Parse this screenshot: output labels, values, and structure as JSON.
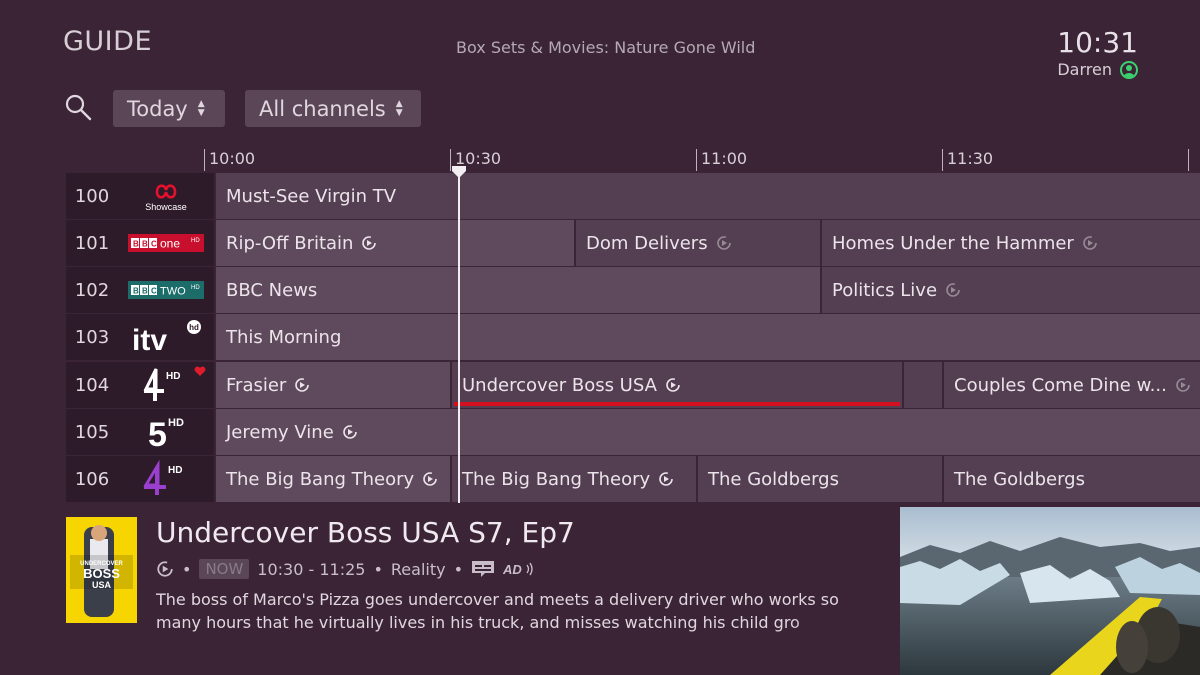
{
  "header": {
    "title": "GUIDE",
    "subtitle": "Box Sets & Movies: Nature Gone Wild",
    "time": "10:31",
    "user": "Darren"
  },
  "filters": {
    "day": "Today",
    "channels": "All channels"
  },
  "timeline": [
    "10:00",
    "10:30",
    "11:00",
    "11:30"
  ],
  "channels": [
    {
      "number": "100",
      "logo": "Showcase",
      "programmes": [
        "Must-See Virgin TV"
      ]
    },
    {
      "number": "101",
      "logo": "BBC one HD",
      "programmes": [
        "Rip-Off Britain",
        "Dom Delivers",
        "Homes Under the Hammer"
      ]
    },
    {
      "number": "102",
      "logo": "BBC TWO HD",
      "programmes": [
        "BBC News",
        "Politics Live"
      ]
    },
    {
      "number": "103",
      "logo": "itv hd",
      "programmes": [
        "This Morning"
      ]
    },
    {
      "number": "104",
      "logo": "4 HD",
      "programmes": [
        "Frasier",
        "Undercover Boss USA",
        "Couples Come Dine w..."
      ]
    },
    {
      "number": "105",
      "logo": "5HD",
      "programmes": [
        "Jeremy Vine"
      ]
    },
    {
      "number": "106",
      "logo": "E4 HD",
      "programmes": [
        "The Big Bang Theory",
        "The Big Bang Theory",
        "The Goldbergs",
        "The Goldbergs"
      ]
    }
  ],
  "details": {
    "title": "Undercover Boss USA S7, Ep7",
    "badge": "NOW",
    "time": "10:30 - 11:25",
    "genre": "Reality",
    "dot": "•",
    "description": "The boss of Marco's Pizza goes undercover and meets a delivery driver who works so many hours that he virtually lives in his truck, and misses watching his child gro",
    "poster_text": "UNDERCOVER BOSS USA",
    "ad_label": "AD"
  },
  "colors": {
    "background": "#3b2436",
    "cell": "#533f51",
    "selected_bar": "#d2101e",
    "user_icon": "#3bd16f"
  }
}
